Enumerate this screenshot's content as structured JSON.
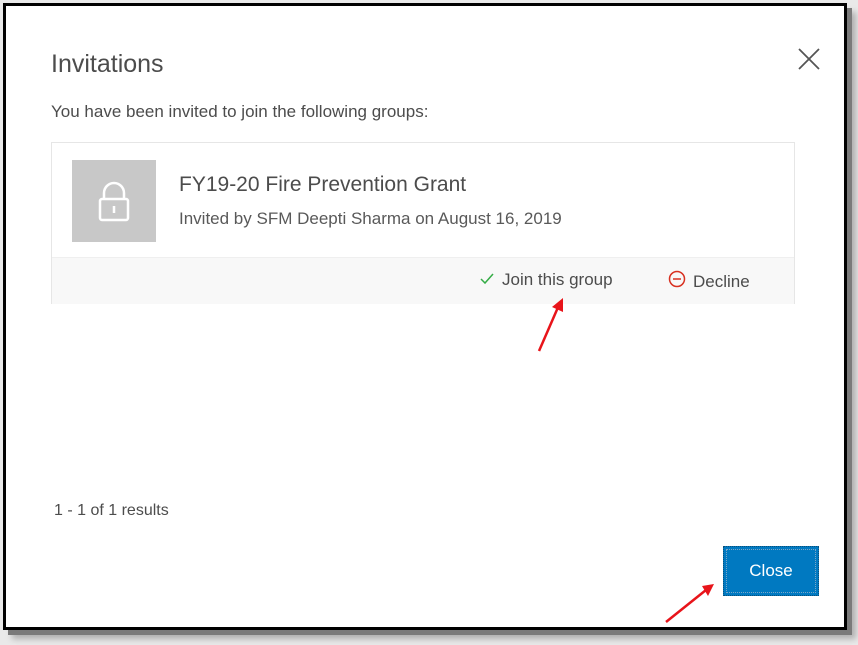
{
  "dialog": {
    "title": "Invitations",
    "subtitle": "You have been invited to join the following groups:",
    "close_icon": "close-x-icon"
  },
  "invitations": [
    {
      "group_name": "FY19-20 Fire Prevention Grant",
      "invited_by": "Invited by SFM Deepti Sharma on August 16, 2019",
      "thumbnail_icon": "lock-icon",
      "join_label": "Join this group",
      "join_icon": "checkmark-icon",
      "decline_label": "Decline",
      "decline_icon": "minus-circle-icon"
    }
  ],
  "footer": {
    "results_text": "1 - 1 of 1 results",
    "close_label": "Close"
  },
  "annotations": {
    "arrow_color": "#e8141a"
  },
  "colors": {
    "accent": "#0079c1",
    "decline_icon": "#d83020",
    "join_icon": "#35ac46"
  }
}
